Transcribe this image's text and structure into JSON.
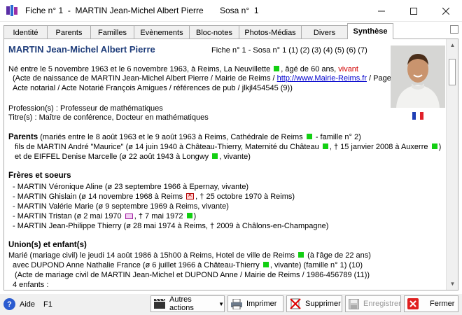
{
  "window": {
    "title": "Fiche n° 1  -  MARTIN Jean-Michel Albert Pierre       Sosa n°  1"
  },
  "tabs": [
    {
      "label": "Identité"
    },
    {
      "label": "Parents"
    },
    {
      "label": "Familles"
    },
    {
      "label": "Evènements"
    },
    {
      "label": "Bloc-notes"
    },
    {
      "label": "Photos-Médias"
    },
    {
      "label": "Divers"
    },
    {
      "label": "Synthèse"
    }
  ],
  "person": {
    "name": "MARTIN Jean-Michel Albert Pierre",
    "refs": "Fiche n° 1  -  Sosa n° 1      (1) (2) (3) (4) (5) (6) (7)"
  },
  "birth": {
    "text": "Né entre le 5 novembre 1963 et le 6 novembre 1963, à Reims, La Neuvillette",
    "age": ", âgé de 60 ans,",
    "status": "vivant",
    "acte_prefix": "(Acte de naissance de MARTIN Jean-Michel Albert Pierre / Mairie de Reims /",
    "acte_link": "http://www.Mairie-Reims.fr",
    "acte_suffix": "/ Page",
    "notary": "Acte notarial / Acte Notarié François Amigues / références de pub / jlkjl454545  (9))"
  },
  "profession": "Profession(s) : Professeur de mathématiques",
  "titles": "Titre(s) : Maître de conférence, Docteur en mathématiques",
  "parents": {
    "heading": "Parents",
    "marriage": " (mariés entre le 8 août 1963 et le 9 août 1963  à Reims, Cathédrale de Reims",
    "family": "- famille n° 2)",
    "father_a": "fils de MARTIN André \"Maurice\" (ø 14 juin 1940 à Château-Thierry, Maternité du Château",
    "father_b": ", † 15 janvier 2008 à Auxerre",
    "father_c": ")",
    "mother_a": "et de EIFFEL Denise Marcelle (ø 22 août 1943 à Longwy",
    "mother_b": ", vivante)"
  },
  "siblings": {
    "heading": "Frères et soeurs",
    "items": [
      {
        "a": "- MARTIN Véronique Aline (ø 23 septembre 1966 à Epernay, vivante)"
      },
      {
        "a": "- MARTIN Ghislain (ø 14 novembre 1968 à Reims",
        "b": ", † 25 octobre 1970 à Reims)"
      },
      {
        "a": "- MARTIN Valérie Marie (ø 9 septembre 1969 à Reims, vivante)"
      },
      {
        "a": "- MARTIN Tristan (ø 2 mai 1970",
        "b": ", † 7 mai 1972",
        "c": ")"
      },
      {
        "a": "- MARTIN Jean-Philippe Thierry (ø 28 mai 1974 à Reims,  † 2009 à Châlons-en-Champagne)"
      }
    ]
  },
  "unions": {
    "heading": "Union(s) et enfant(s)",
    "marriage_a": "Marié (mariage civil) le jeudi 14 août 1986 à 15h00  à Reims, Hotel de ville de Reims",
    "marriage_b": "(à l'âge de 22 ans)",
    "spouse_a": "avec DUPOND Anne Nathalie France (ø 6 juillet 1966 à Château-Thierry",
    "spouse_b": ", vivante)  (famille n° 1)     (10)",
    "acte": "(Acte de mariage civil de MARTIN Jean-Michel et DUPOND Anne / Mairie de Reims / 1986-456789  (11))",
    "children": "4 enfants :"
  },
  "footer": {
    "help_label": "Aide",
    "help_key": "F1",
    "actions": "Autres actions",
    "print": "Imprimer",
    "delete": "Supprimer",
    "save": "Enregistrer",
    "close": "Fermer"
  },
  "colors": {
    "name": "#1f3d7a",
    "status_living": "#d00000",
    "marker_green": "#13cf13"
  }
}
